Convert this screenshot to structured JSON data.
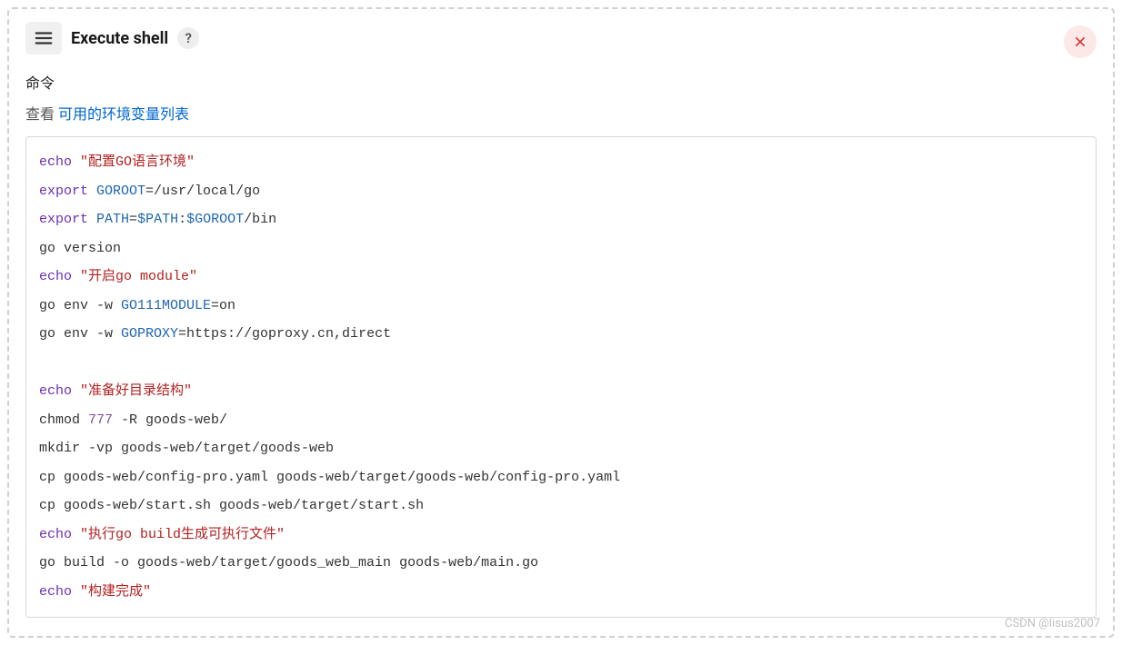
{
  "header": {
    "title": "Execute shell",
    "help_label": "?"
  },
  "field": {
    "label": "命令",
    "help_prefix": "查看 ",
    "help_link_text": "可用的环境变量列表"
  },
  "code": {
    "lines": [
      {
        "t": [
          {
            "c": "tok-kw",
            "v": "echo"
          },
          {
            "c": "",
            "v": " "
          },
          {
            "c": "tok-str",
            "v": "\"配置GO语言环境\""
          }
        ]
      },
      {
        "t": [
          {
            "c": "tok-kw",
            "v": "export"
          },
          {
            "c": "",
            "v": " "
          },
          {
            "c": "tok-var",
            "v": "GOROOT"
          },
          {
            "c": "",
            "v": "=/usr/local/go"
          }
        ]
      },
      {
        "t": [
          {
            "c": "tok-kw",
            "v": "export"
          },
          {
            "c": "",
            "v": " "
          },
          {
            "c": "tok-var",
            "v": "PATH"
          },
          {
            "c": "",
            "v": "="
          },
          {
            "c": "tok-var",
            "v": "$PATH"
          },
          {
            "c": "",
            "v": ":"
          },
          {
            "c": "tok-var",
            "v": "$GOROOT"
          },
          {
            "c": "",
            "v": "/bin"
          }
        ]
      },
      {
        "t": [
          {
            "c": "",
            "v": "go version"
          }
        ]
      },
      {
        "t": [
          {
            "c": "tok-kw",
            "v": "echo"
          },
          {
            "c": "",
            "v": " "
          },
          {
            "c": "tok-str",
            "v": "\"开启go module\""
          }
        ]
      },
      {
        "t": [
          {
            "c": "",
            "v": "go env -w "
          },
          {
            "c": "tok-var",
            "v": "GO111MODULE"
          },
          {
            "c": "",
            "v": "=on"
          }
        ]
      },
      {
        "t": [
          {
            "c": "",
            "v": "go env -w "
          },
          {
            "c": "tok-var",
            "v": "GOPROXY"
          },
          {
            "c": "",
            "v": "=https://goproxy.cn,direct"
          }
        ]
      },
      {
        "t": [
          {
            "c": "",
            "v": ""
          }
        ]
      },
      {
        "t": [
          {
            "c": "tok-kw",
            "v": "echo"
          },
          {
            "c": "",
            "v": " "
          },
          {
            "c": "tok-str",
            "v": "\"准备好目录结构\""
          }
        ]
      },
      {
        "t": [
          {
            "c": "",
            "v": "chmod "
          },
          {
            "c": "tok-num",
            "v": "777"
          },
          {
            "c": "",
            "v": " -R goods-web/"
          }
        ]
      },
      {
        "t": [
          {
            "c": "",
            "v": "mkdir -vp goods-web/target/goods-web"
          }
        ]
      },
      {
        "t": [
          {
            "c": "",
            "v": "cp goods-web/config-pro.yaml goods-web/target/goods-web/config-pro.yaml"
          }
        ]
      },
      {
        "t": [
          {
            "c": "",
            "v": "cp goods-web/start.sh goods-web/target/start.sh"
          }
        ]
      },
      {
        "t": [
          {
            "c": "tok-kw",
            "v": "echo"
          },
          {
            "c": "",
            "v": " "
          },
          {
            "c": "tok-str",
            "v": "\"执行go build生成可执行文件\""
          }
        ]
      },
      {
        "t": [
          {
            "c": "",
            "v": "go build -o goods-web/target/goods_web_main goods-web/main.go"
          }
        ]
      },
      {
        "t": [
          {
            "c": "tok-kw",
            "v": "echo"
          },
          {
            "c": "",
            "v": " "
          },
          {
            "c": "tok-str",
            "v": "\"构建完成\""
          }
        ]
      }
    ]
  },
  "watermark": "CSDN @lisus2007"
}
